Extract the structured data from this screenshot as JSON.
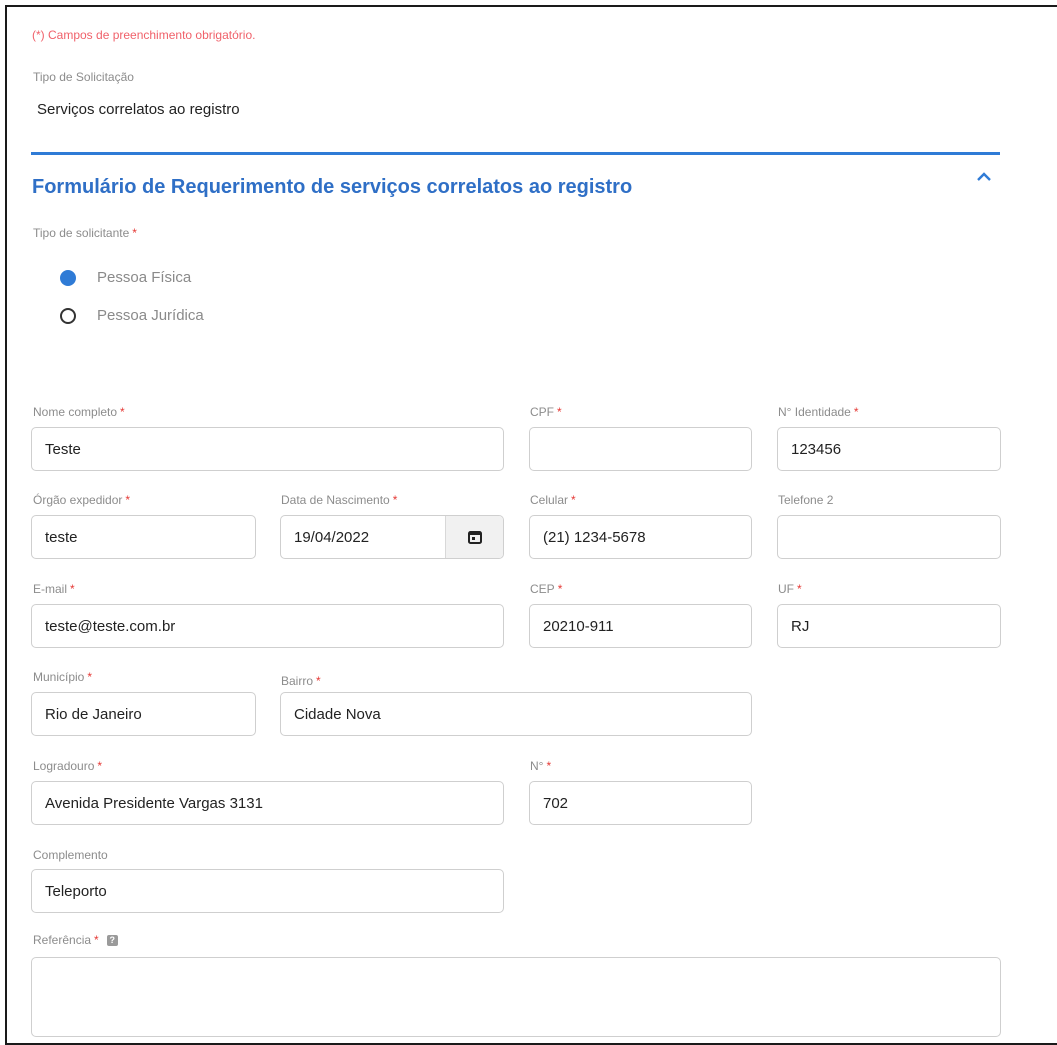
{
  "notice": "(*) Campos de preenchimento obrigatório.",
  "request_type": {
    "label": "Tipo de Solicitação",
    "value": "Serviços correlatos ao registro"
  },
  "section": {
    "title": "Formulário de Requerimento de serviços correlatos ao registro"
  },
  "requester_type": {
    "label": "Tipo de solicitante",
    "options": [
      {
        "label": "Pessoa Física",
        "selected": true
      },
      {
        "label": "Pessoa Jurídica",
        "selected": false
      }
    ]
  },
  "required_mark": "*",
  "help_glyph": "?",
  "fields": {
    "nome": {
      "label": "Nome completo",
      "value": "Teste"
    },
    "cpf": {
      "label": "CPF",
      "value": ""
    },
    "identidade": {
      "label": "N° Identidade",
      "value": "123456"
    },
    "orgao": {
      "label": "Órgão expedidor",
      "value": "teste"
    },
    "nascimento": {
      "label": "Data de Nascimento",
      "value": "19/04/2022"
    },
    "celular": {
      "label": "Celular",
      "value": "(21) 1234-5678"
    },
    "telefone2": {
      "label": "Telefone 2",
      "value": ""
    },
    "email": {
      "label": "E-mail",
      "value": "teste@teste.com.br"
    },
    "cep": {
      "label": "CEP",
      "value": "20210-911"
    },
    "uf": {
      "label": "UF",
      "value": "RJ"
    },
    "municipio": {
      "label": "Município",
      "value": "Rio de Janeiro"
    },
    "bairro": {
      "label": "Bairro",
      "value": "Cidade Nova"
    },
    "logradouro": {
      "label": "Logradouro",
      "value": "Avenida Presidente Vargas 3131"
    },
    "numero": {
      "label": "N°",
      "value": "702"
    },
    "complemento": {
      "label": "Complemento",
      "value": "Teleporto"
    },
    "referencia": {
      "label": "Referência",
      "value": ""
    }
  },
  "icons": {
    "collapse": "chevron-up-icon",
    "calendar": "calendar-icon",
    "help": "help-icon"
  },
  "colors": {
    "accent": "#2f7bd6",
    "title": "#2f6fc6",
    "required": "#e53935",
    "notice": "#f0616a"
  }
}
